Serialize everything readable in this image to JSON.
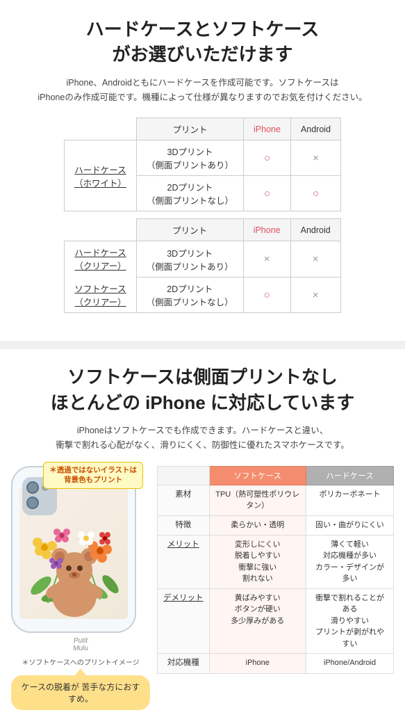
{
  "top": {
    "title": "ハードケースとソフトケース\nがお選びいただけます",
    "desc": "iPhone、Androidともにハードケースを作成可能です。ソフトケースは\niPhoneのみ作成可能です。機種によって仕様が異なりますのでお気を付けください。",
    "table1": {
      "col_print": "プリント",
      "col_iphone": "iPhone",
      "col_android": "Android",
      "left1": "ハードケース\n（ホワイト）",
      "row1_label": "3Dプリント\n（側面プリントあり）",
      "row1_iphone": "○",
      "row1_android": "×",
      "row2_label": "2Dプリント\n（側面プリントなし）",
      "row2_iphone": "○",
      "row2_android": "○"
    },
    "table2": {
      "col_print": "プリント",
      "col_iphone": "iPhone",
      "col_android": "Android",
      "left1": "ハードケース\n（クリアー）",
      "left2": "ソフトケース\n（クリアー）",
      "row1_label": "3Dプリント\n（側面プリントあり）",
      "row1_iphone": "×",
      "row1_android": "×",
      "row2_label": "2Dプリント\n（側面プリントなし）",
      "row2_iphone": "○",
      "row2_android": "×"
    }
  },
  "bottom": {
    "title": "ソフトケースは側面プリントなし\nほとんどの iPhone に対応しています",
    "desc": "iPhoneはソフトケースでも作成できます。ハードケースと違い、\n衝撃で割れる心配がなく、滑りにくく、防御性に優れたスマホケースです。",
    "phone_sticker": "*透過ではないイラストは\n背景色もプリント",
    "phone_caption": "＊ソフトケースへのプリントイメージ",
    "callout": "ケースの脱着が\n苦手な方におすすめ。",
    "spec_table": {
      "col_soft": "ソフトケース",
      "col_hard": "ハードケース",
      "rows": [
        {
          "label": "素材",
          "soft": "TPU（熱可塑性ポリウレタン）",
          "hard": "ポリカーボネート"
        },
        {
          "label": "特徴",
          "soft": "柔らかい・透明",
          "hard": "固い・曲がりにくい"
        },
        {
          "label": "メリット",
          "soft": "変形しにくい\n脱着しやすい\n衝撃に強い\n割れない",
          "hard": "薄くて軽い\n対応機種が多い\nカラー・デザインが多い"
        },
        {
          "label": "デメリット",
          "soft": "黄ばみやすい\nボタンが硬い\n多少厚みがある",
          "hard": "衝撃で割れることがある\n滑りやすい\nプリントが剥がれやすい"
        },
        {
          "label": "対応機種",
          "soft": "iPhone",
          "hard": "iPhone/Android"
        }
      ]
    }
  }
}
